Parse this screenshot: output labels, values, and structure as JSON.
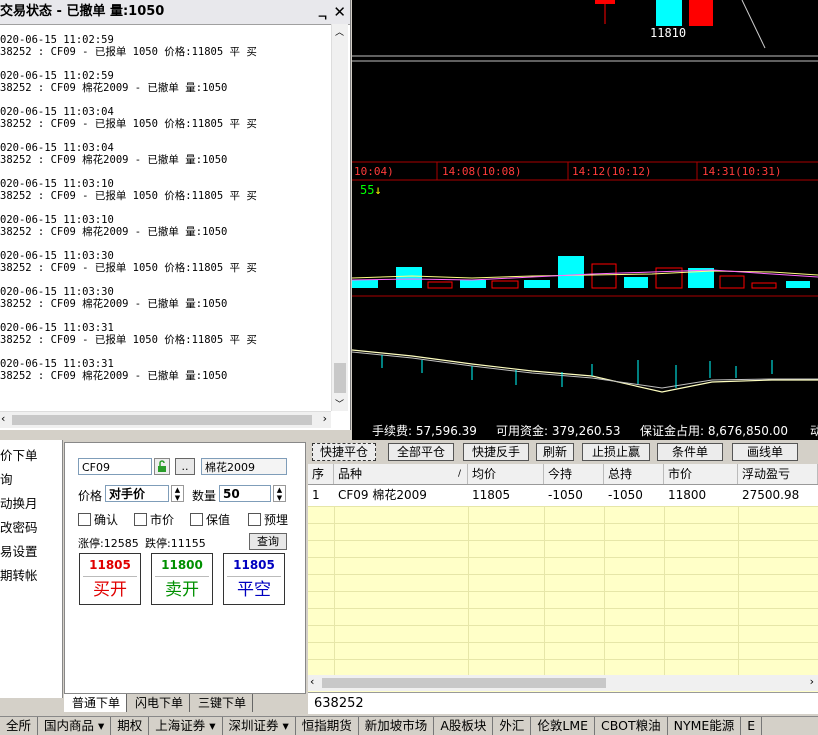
{
  "chart": {
    "price_label": "11810",
    "time_labels": [
      "10:04)",
      "14:08(10:08)",
      "14:12(10:12)",
      "14:31(10:31)"
    ],
    "volume_label": "55",
    "colors": {
      "up": "#ff0000",
      "down": "#00ffff",
      "ma": "#ffff80"
    }
  },
  "status": {
    "title": "交易状态 - 已撤单 量:1050",
    "pin": "ᆨ",
    "close": "✕",
    "entries": [
      {
        "time": "020-06-15 11:02:59",
        "msg": "38252 : CF09 - 已报单 1050 价格:11805 平 买"
      },
      {
        "time": "020-06-15 11:02:59",
        "msg": "38252 : CF09 棉花2009 - 已撤单 量:1050"
      },
      {
        "time": "020-06-15 11:03:04",
        "msg": "38252 : CF09 - 已报单 1050 价格:11805 平 买"
      },
      {
        "time": "020-06-15 11:03:04",
        "msg": "38252 : CF09 棉花2009 - 已撤单 量:1050"
      },
      {
        "time": "020-06-15 11:03:10",
        "msg": "38252 : CF09 - 已报单 1050 价格:11805 平 买"
      },
      {
        "time": "020-06-15 11:03:10",
        "msg": "38252 : CF09 棉花2009 - 已撤单 量:1050"
      },
      {
        "time": "020-06-15 11:03:30",
        "msg": "38252 : CF09 - 已报单 1050 价格:11805 平 买"
      },
      {
        "time": "020-06-15 11:03:30",
        "msg": "38252 : CF09 棉花2009 - 已撤单 量:1050"
      },
      {
        "time": "020-06-15 11:03:31",
        "msg": "38252 : CF09 - 已报单 1050 价格:11805 平 买"
      },
      {
        "time": "020-06-15 11:03:31",
        "msg": "38252 : CF09 棉花2009 - 已撤单 量:1050"
      }
    ]
  },
  "account": {
    "fee": "手续费: 57,596.39",
    "available": "可用资金: 379,260.53",
    "margin": "保证金占用: 8,676,850.00",
    "more": "动"
  },
  "left_menu": [
    "价下单",
    "询",
    "动换月",
    "改密码",
    "易设置",
    "期转帐"
  ],
  "order_form": {
    "code": "CF09",
    "name": "棉花2009",
    "dots": "..",
    "price_label": "价格",
    "price_value": "对手价",
    "qty_label": "数量",
    "qty_value": "50",
    "options": [
      "确认",
      "市价",
      "保值",
      "预埋"
    ],
    "limit_up": "涨停:12585",
    "limit_down": "跌停:11155",
    "query": "查询",
    "buttons": [
      {
        "price": "11805",
        "action": "买开",
        "color": "#e00000"
      },
      {
        "price": "11800",
        "action": "卖开",
        "color": "#009000"
      },
      {
        "price": "11805",
        "action": "平空",
        "color": "#0000c0"
      }
    ]
  },
  "form_tabs": [
    "普通下单",
    "闪电下单",
    "三键下单"
  ],
  "toolbar": [
    "快捷平仓",
    "全部平仓",
    "快捷反手",
    "刷新",
    "止损止赢",
    "条件单",
    "画线单"
  ],
  "table": {
    "headers": [
      "序",
      "品种",
      "均价",
      "今持",
      "总持",
      "市价",
      "浮动盈亏"
    ],
    "rows": [
      [
        "1",
        "CF09 棉花2009",
        "11805",
        "-1050",
        "-1050",
        "11800",
        "27500.98"
      ]
    ]
  },
  "account_id": "638252",
  "market_bar": [
    "全所",
    "国内商品 ▾",
    "期权",
    "上海证券 ▾",
    "深圳证券 ▾",
    "恒指期货",
    "新加坡市场",
    "A股板块",
    "外汇",
    "伦敦LME",
    "CBOT粮油",
    "NYME能源",
    "E"
  ]
}
